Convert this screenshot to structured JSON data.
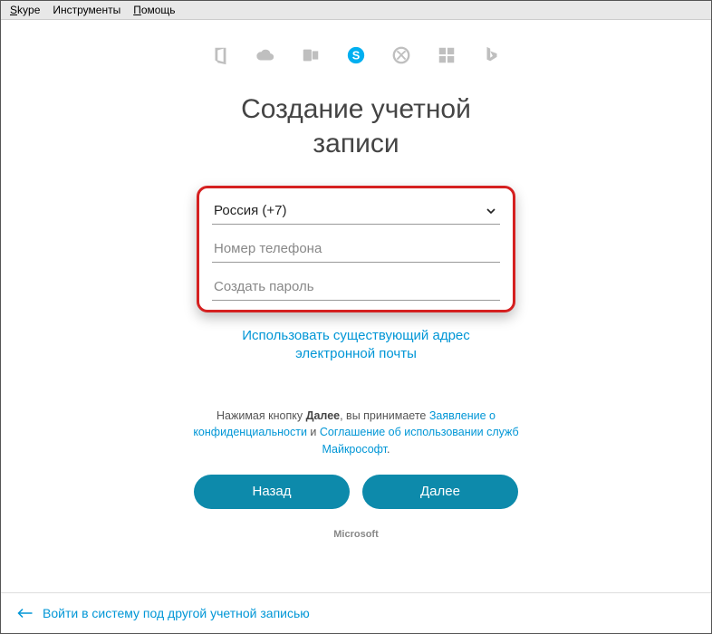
{
  "menubar": {
    "skype": "Skype",
    "tools": "Инструменты",
    "help": "Помощь"
  },
  "title_line1": "Создание учетной",
  "title_line2": "записи",
  "form": {
    "country_selected": "Россия (+7)",
    "phone_placeholder": "Номер телефона",
    "password_placeholder": "Создать пароль"
  },
  "email_link_line1": "Использовать существующий адрес",
  "email_link_line2": "электронной почты",
  "terms": {
    "prefix": "Нажимая кнопку ",
    "next_word": "Далее",
    "mid": ", вы принимаете ",
    "privacy": "Заявление о конфиденциальности",
    "and": " и ",
    "agreement": "Соглашение об использовании служб Майкрософт",
    "suffix": "."
  },
  "buttons": {
    "back": "Назад",
    "next": "Далее"
  },
  "brand": "Microsoft",
  "bottom_link": "Войти в систему под другой учетной записью"
}
